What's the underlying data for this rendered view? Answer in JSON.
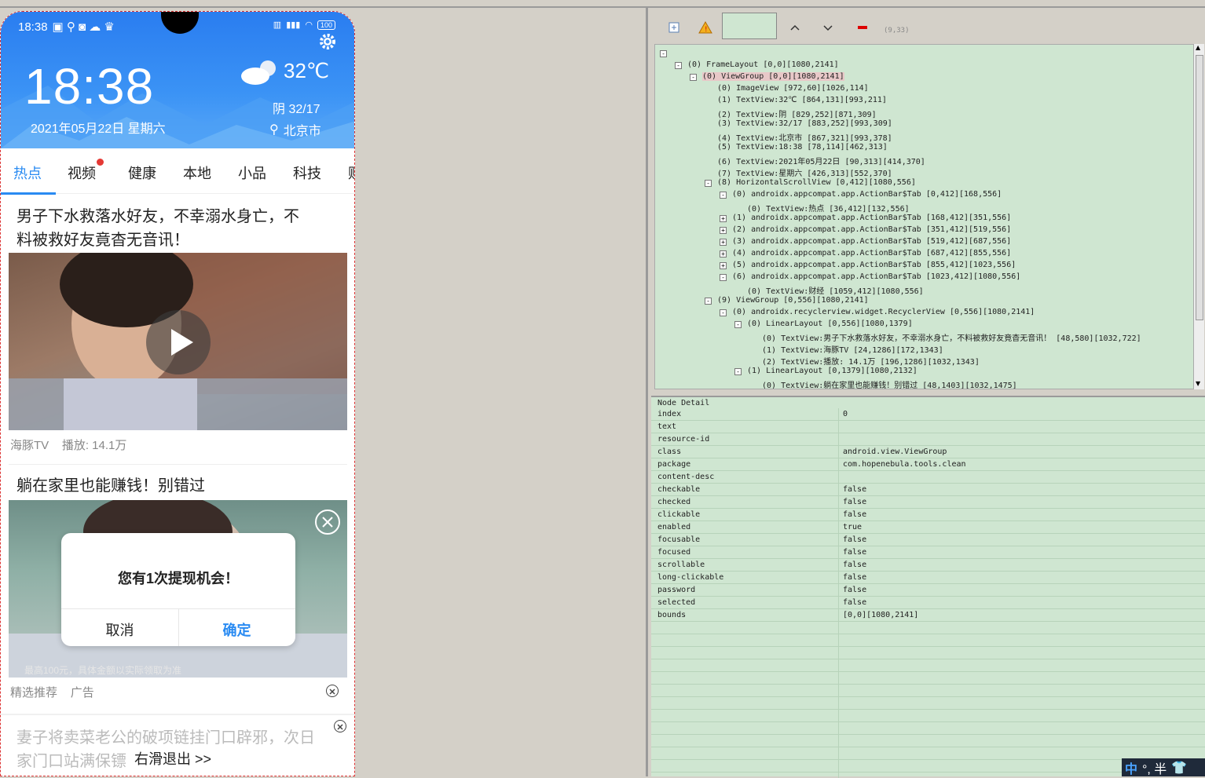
{
  "phone": {
    "status": {
      "time": "18:38",
      "battery": "100"
    },
    "clock": "18:38",
    "date": "2021年05月22日 星期六",
    "temp": "32℃",
    "weather": "阴 32/17",
    "city": "北京市",
    "tabs": [
      "热点",
      "视频",
      "健康",
      "本地",
      "小品",
      "科技",
      "财"
    ],
    "article1": {
      "title_line1": "男子下水救落水好友，不幸溺水身亡，不",
      "title_line2": "料被救好友竟杳无音讯！",
      "source": "海豚TV",
      "plays": "播放: 14.1万"
    },
    "article2": {
      "title": "躺在家里也能赚钱！别错过",
      "caption": "最高100元，具体金额以实际领取为准",
      "source": "精选推荐",
      "ad": "广告"
    },
    "dialog": {
      "message": "您有1次提现机会！",
      "cancel": "取消",
      "ok": "确定"
    },
    "article3": {
      "title_line1": "妻子将卖菜老公的破项链挂门口辟邪，次日",
      "title_line2": "家门口站满保镖"
    },
    "swipe_exit": "右滑退出 >>"
  },
  "toolbar": {
    "coords": "(9,33)"
  },
  "tree": [
    {
      "indent": 0,
      "box": "-",
      "text": "",
      "hl": false
    },
    {
      "indent": 1,
      "box": "-",
      "text": "(0) FrameLayout [0,0][1080,2141]",
      "hl": false
    },
    {
      "indent": 2,
      "box": "-",
      "text": "(0) ViewGroup [0,0][1080,2141]",
      "hl": true
    },
    {
      "indent": 3,
      "box": "",
      "text": "(0) ImageView [972,60][1026,114]",
      "hl": false
    },
    {
      "indent": 3,
      "box": "",
      "text": "(1) TextView:32℃ [864,131][993,211]",
      "hl": false
    },
    {
      "indent": 3,
      "box": "",
      "text": "(2) TextView:阴 [829,252][871,309]",
      "hl": false
    },
    {
      "indent": 3,
      "box": "",
      "text": "(3) TextView:32/17 [883,252][993,309]",
      "hl": false
    },
    {
      "indent": 3,
      "box": "",
      "text": "(4) TextView:北京市 [867,321][993,378]",
      "hl": false
    },
    {
      "indent": 3,
      "box": "",
      "text": "(5) TextView:18:38 [78,114][462,313]",
      "hl": false
    },
    {
      "indent": 3,
      "box": "",
      "text": "(6) TextView:2021年05月22日 [90,313][414,370]",
      "hl": false
    },
    {
      "indent": 3,
      "box": "",
      "text": "(7) TextView:星期六 [426,313][552,370]",
      "hl": false
    },
    {
      "indent": 3,
      "box": "-",
      "text": "(8) HorizontalScrollView [0,412][1080,556]",
      "hl": false
    },
    {
      "indent": 4,
      "box": "-",
      "text": "(0) androidx.appcompat.app.ActionBar$Tab [0,412][168,556]",
      "hl": false
    },
    {
      "indent": 5,
      "box": "",
      "text": "(0) TextView:热点 [36,412][132,556]",
      "hl": false
    },
    {
      "indent": 4,
      "box": "+",
      "text": "(1) androidx.appcompat.app.ActionBar$Tab [168,412][351,556]",
      "hl": false
    },
    {
      "indent": 4,
      "box": "+",
      "text": "(2) androidx.appcompat.app.ActionBar$Tab [351,412][519,556]",
      "hl": false
    },
    {
      "indent": 4,
      "box": "+",
      "text": "(3) androidx.appcompat.app.ActionBar$Tab [519,412][687,556]",
      "hl": false
    },
    {
      "indent": 4,
      "box": "+",
      "text": "(4) androidx.appcompat.app.ActionBar$Tab [687,412][855,556]",
      "hl": false
    },
    {
      "indent": 4,
      "box": "+",
      "text": "(5) androidx.appcompat.app.ActionBar$Tab [855,412][1023,556]",
      "hl": false
    },
    {
      "indent": 4,
      "box": "-",
      "text": "(6) androidx.appcompat.app.ActionBar$Tab [1023,412][1080,556]",
      "hl": false
    },
    {
      "indent": 5,
      "box": "",
      "text": "(0) TextView:财经 [1059,412][1080,556]",
      "hl": false
    },
    {
      "indent": 3,
      "box": "-",
      "text": "(9) ViewGroup [0,556][1080,2141]",
      "hl": false
    },
    {
      "indent": 4,
      "box": "-",
      "text": "(0) androidx.recyclerview.widget.RecyclerView [0,556][1080,2141]",
      "hl": false
    },
    {
      "indent": 5,
      "box": "-",
      "text": "(0) LinearLayout [0,556][1080,1379]",
      "hl": false
    },
    {
      "indent": 6,
      "box": "",
      "text": "(0) TextView:男子下水救落水好友，不幸溺水身亡，不料被救好友竟杳无音讯！ [48,580][1032,722]",
      "hl": false
    },
    {
      "indent": 6,
      "box": "",
      "text": "(1) TextView:海豚TV [24,1286][172,1343]",
      "hl": false
    },
    {
      "indent": 6,
      "box": "",
      "text": "(2) TextView:播放: 14.1万 [196,1286][1032,1343]",
      "hl": false
    },
    {
      "indent": 5,
      "box": "-",
      "text": "(1) LinearLayout [0,1379][1080,2132]",
      "hl": false
    },
    {
      "indent": 6,
      "box": "",
      "text": "(0) TextView:躺在家里也能赚钱！别错过 [48,1403][1032,1475]",
      "hl": false
    }
  ],
  "detail": {
    "title": "Node Detail",
    "rows": [
      {
        "k": "index",
        "v": "0"
      },
      {
        "k": "text",
        "v": ""
      },
      {
        "k": "resource-id",
        "v": ""
      },
      {
        "k": "class",
        "v": "android.view.ViewGroup"
      },
      {
        "k": "package",
        "v": "com.hopenebula.tools.clean"
      },
      {
        "k": "content-desc",
        "v": ""
      },
      {
        "k": "checkable",
        "v": "false"
      },
      {
        "k": "checked",
        "v": "false"
      },
      {
        "k": "clickable",
        "v": "false"
      },
      {
        "k": "enabled",
        "v": "true"
      },
      {
        "k": "focusable",
        "v": "false"
      },
      {
        "k": "focused",
        "v": "false"
      },
      {
        "k": "scrollable",
        "v": "false"
      },
      {
        "k": "long-clickable",
        "v": "false"
      },
      {
        "k": "password",
        "v": "false"
      },
      {
        "k": "selected",
        "v": "false"
      },
      {
        "k": "bounds",
        "v": "[0,0][1080,2141]"
      }
    ]
  },
  "ime": {
    "lang": "中",
    "mode": "°, 半"
  },
  "colors": {
    "accent": "#2a8bf2",
    "tree_bg": "#cfe6d1",
    "hero": "#2a7df0"
  }
}
